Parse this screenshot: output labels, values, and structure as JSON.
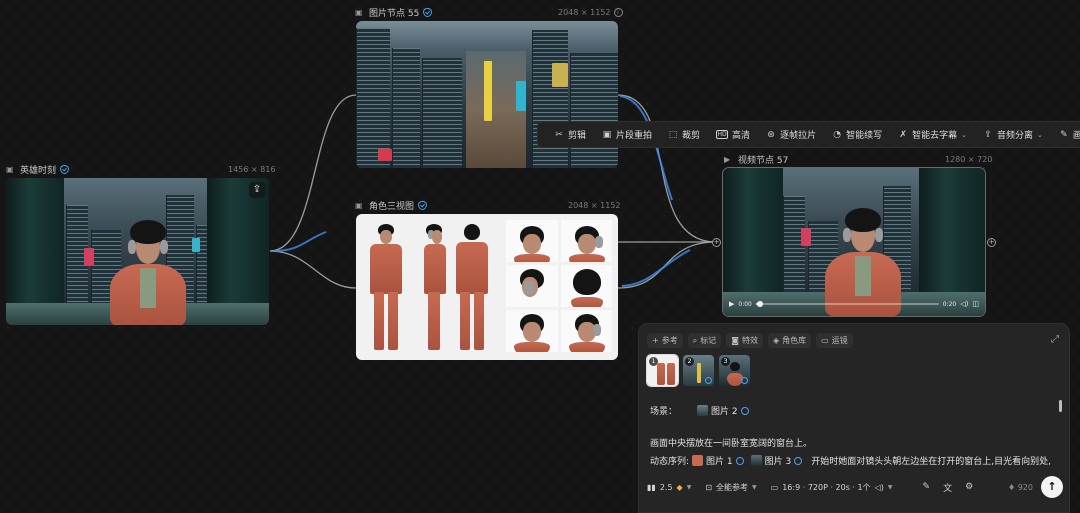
{
  "nodes": {
    "hero": {
      "title": "英雄时刻",
      "dimensions": "1456 × 816"
    },
    "image55": {
      "title": "图片节点 55",
      "dimensions": "2048 × 1152"
    },
    "character": {
      "title": "角色三视图",
      "dimensions": "2048 × 1152"
    },
    "video57": {
      "title": "视频节点 57",
      "dimensions": "1280 × 720",
      "time_current": "0:00",
      "time_total": "0:20",
      "progress": 0.02
    }
  },
  "toolbar": {
    "items": [
      {
        "label": "剪辑",
        "icon": "scissors-icon",
        "glyph": "✂"
      },
      {
        "label": "片段重拍",
        "icon": "film-icon",
        "glyph": "▣"
      },
      {
        "label": "裁剪",
        "icon": "crop-icon",
        "glyph": "⬚"
      },
      {
        "label": "高清",
        "icon": "hd-icon",
        "glyph": "HD"
      },
      {
        "label": "逐帧拉片",
        "icon": "frames-icon",
        "glyph": "⊛"
      },
      {
        "label": "智能续写",
        "icon": "continue-icon",
        "glyph": "◔"
      },
      {
        "label": "智能去字幕",
        "icon": "erase-subtitle-icon",
        "glyph": "✗"
      },
      {
        "label": "音频分离",
        "icon": "audio-split-icon",
        "glyph": "⇪"
      },
      {
        "label": "画面编",
        "icon": "edit-frame-icon",
        "glyph": "✎"
      }
    ]
  },
  "panel": {
    "chips": [
      {
        "label": "参考",
        "icon": "plus-icon",
        "glyph": "+"
      },
      {
        "label": "标记",
        "icon": "mark-icon",
        "glyph": "⌕"
      },
      {
        "label": "特效",
        "icon": "effects-icon",
        "glyph": "◙"
      },
      {
        "label": "角色库",
        "icon": "character-lib-icon",
        "glyph": "◈"
      },
      {
        "label": "运镜",
        "icon": "camera-move-icon",
        "glyph": "▭"
      }
    ],
    "thumb_numbers": [
      "1",
      "2",
      "3"
    ],
    "scene_label": "场景：",
    "scene_ref": "图片 2",
    "description": "画面中央摆放在一间卧室宽阔的窗台上。",
    "sequence_label": "动态序列:",
    "seq_ref1": "图片 1",
    "seq_ref2": "图片 3",
    "sequence_text": "开始时她面对镜头头朝左边坐在打开的窗台上,目光看向别处,",
    "model_version": "2.5",
    "reference_mode": "全能参考",
    "video_settings": "16:9 · 720P · 20s · 1个",
    "credits": "920"
  }
}
